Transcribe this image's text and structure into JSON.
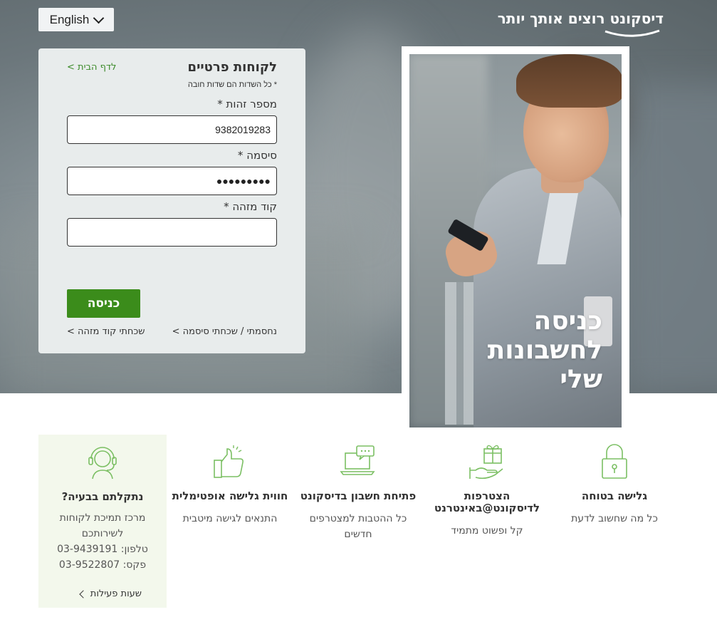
{
  "header": {
    "language_label": "English",
    "logo_text": "דיסקונט רוצים אותך יותר",
    "logo_color": "#ffffff"
  },
  "login": {
    "title": "לקוחות פרטיים",
    "home_link": "לדף הבית >",
    "required_note": "* כל השדות הם שדות חובה",
    "id_label": "מספר זהות *",
    "id_value": "9382019283",
    "password_label": "סיסמה *",
    "password_value": "●●●●●●●●●",
    "code_label": "קוד מזהה *",
    "code_value": "",
    "submit_label": "כניסה",
    "forgot_password": "נחסמתי / שכחתי סיסמה >",
    "forgot_code": "שכחתי קוד מזהה >",
    "accent_color": "#3b8c1b"
  },
  "hero": {
    "line1": "כניסה",
    "line2": "לחשבונות",
    "line3": "שלי"
  },
  "features": [
    {
      "icon": "lock-icon",
      "title": "גלישה בטוחה",
      "desc": "כל מה שחשוב לדעת"
    },
    {
      "icon": "gift-hand-icon",
      "title": "הצטרפות לדיסקונט@באינטרנט",
      "desc": "קל ופשוט מתמיד"
    },
    {
      "icon": "laptop-chat-icon",
      "title": "פתיחת חשבון בדיסקונט",
      "desc": "כל ההטבות למצטרפים חדשים"
    },
    {
      "icon": "thumbs-up-icon",
      "title": "חווית גלישה אופטימלית",
      "desc": "התנאים לגישה מיטבית"
    }
  ],
  "support": {
    "icon": "headset-agent-icon",
    "title": "נתקלתם בבעיה?",
    "line1": "מרכז תמיכת לקוחות",
    "line2": "לשירותכם",
    "phone": "טלפון: 03-9439191",
    "fax": "פקס: 03-9522807",
    "hours": "שעות פעילות"
  }
}
